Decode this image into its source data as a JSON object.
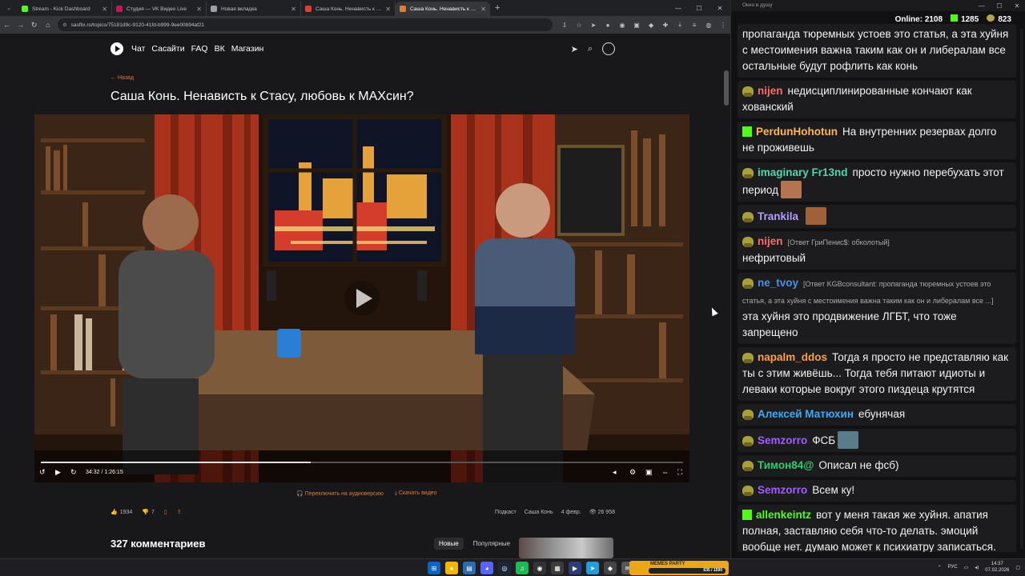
{
  "tabs": [
    {
      "title": "Stream - Kick Dashboard",
      "color": "#53fc18",
      "active": false
    },
    {
      "title": "Студия — VK Видео Live",
      "color": "#c2185b",
      "active": false
    },
    {
      "title": "Новая вкладка",
      "color": "#9aa0a6",
      "active": false
    },
    {
      "title": "Саша Конь. Ненависть к Стасу",
      "color": "#e53935",
      "active": false
    },
    {
      "title": "Саша Конь. Ненависть к Стасу",
      "color": "#e07a3a",
      "active": true
    }
  ],
  "url": "sasflix.ru/topics/75181d9c-9120-41fd-b999-9ee00b94af21",
  "site_nav": {
    "links": [
      "Чат",
      "Сасайти",
      "FAQ",
      "ВК",
      "Магазин"
    ]
  },
  "page": {
    "back_label": "← Назад",
    "title": "Саша Конь. Ненависть к Стасу, любовь к МАХсин?",
    "video_time": "34:32 / 1:26:15",
    "progress": 0.42,
    "audio_link": "Переключить на аудиоверсию",
    "download_link": "Скачать видео",
    "likes": "1934",
    "dislikes": "7",
    "tag1": "Подкаст",
    "tag2": "Саша Конь",
    "date": "4 февр.",
    "views": "26 958",
    "comments_count": "327 комментариев",
    "sort_new": "Новые",
    "sort_popular": "Популярные"
  },
  "chat": {
    "window_title": "Окно в душу",
    "online_label": "Online:",
    "online_count": "2108",
    "kick_count": "1285",
    "other_count": "823",
    "messages": [
      {
        "badge": "none",
        "user": "",
        "color": "#fff",
        "reply": "",
        "text": "пропаганда тюремных устоев это статья, а эта хуйня с местоимения важна таким как он и либералам все остальные будут рофлить как конь",
        "emote": ""
      },
      {
        "badge": "pepe",
        "user": "nijen",
        "color": "#ff6b6b",
        "reply": "",
        "text": "недисциплинированные кончают как хованский",
        "emote": ""
      },
      {
        "badge": "kick",
        "user": "PerdunHohotun",
        "color": "#ffb84d",
        "reply": "",
        "text": "На внутренних резервах долго не проживешь",
        "emote": ""
      },
      {
        "badge": "pepe",
        "user": "imaginary Fr13nd",
        "color": "#52d6a8",
        "reply": "",
        "text": "просто нужно перебухать этот период",
        "emote": "#b5744f"
      },
      {
        "badge": "pepe",
        "user": "Trankila",
        "color": "#b39dff",
        "reply": "",
        "text": "",
        "emote": "#a0603a"
      },
      {
        "badge": "pepe",
        "user": "nijen",
        "color": "#ff6b6b",
        "reply": "[Ответ ГриПенис$: обколотый]",
        "text": "нефритовый",
        "emote": ""
      },
      {
        "badge": "pepe",
        "user": "ne_tvoy",
        "color": "#4a90e2",
        "reply": "[Ответ KGBconsultant: пропаганда тюремных устоев это статья, а эта хуйня с местоимения важна таким как он и либералам все ...]",
        "text": "эта хуйня это продвижение ЛГБТ, что тоже запрещено",
        "emote": ""
      },
      {
        "badge": "pepe",
        "user": "napalm_ddos",
        "color": "#ff9f43",
        "reply": "",
        "text": "Тогда я просто не представляю как ты с этим живёшь... Тогда тебя питают идиоты и леваки которые вокруг этого пиздеца крутятся",
        "emote": ""
      },
      {
        "badge": "pepe",
        "user": "Алексей Матюхин",
        "color": "#3fa9f5",
        "reply": "",
        "text": "ебунячая",
        "emote": ""
      },
      {
        "badge": "pepe",
        "user": "Semzorro",
        "color": "#a25cff",
        "reply": "",
        "text": "ФСБ",
        "emote": "#5a7c8a"
      },
      {
        "badge": "pepe",
        "user": "Тимон84@",
        "color": "#2ecc71",
        "reply": "",
        "text": "Описал не фсб)",
        "emote": ""
      },
      {
        "badge": "pepe",
        "user": "Semzorro",
        "color": "#a25cff",
        "reply": "",
        "text": "Всем ку!",
        "emote": ""
      },
      {
        "badge": "kick",
        "user": "allenkeintz",
        "color": "#53fc18",
        "reply": "",
        "text": "вот у меня такая же хуйня. апатия полная, заставляю себя что-то делать. эмоций вообще нет. думаю может к психиатру записаться. может таблеток выпишут.",
        "emote": ""
      }
    ]
  },
  "taskbar": {
    "memes_label": "MEMES PARTY",
    "memes_progress": "635 / 1590",
    "lang": "РУС",
    "time": "14:37",
    "date": "07.02.2026"
  }
}
